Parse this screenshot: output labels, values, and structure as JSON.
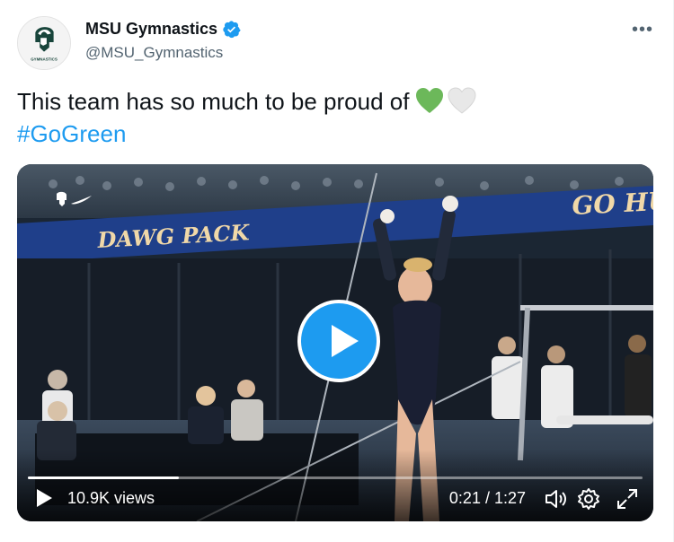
{
  "account": {
    "display_name": "MSU Gymnastics",
    "handle": "@MSU_Gymnastics",
    "avatar_text": "GYMNASTICS"
  },
  "tweet": {
    "text": "This team has so much to be proud of",
    "hashtag": "#GoGreen",
    "emojis": [
      "green-heart",
      "white-heart"
    ]
  },
  "video": {
    "views": "10.9K views",
    "time": "0:21 / 1:27",
    "progress": 0.245,
    "banner_left": "DAWG PACK",
    "banner_right": "GO HU"
  },
  "colors": {
    "accent": "#1d9bf0",
    "text": "#0f1419",
    "secondary": "#536471",
    "green_heart": "#6cb85a"
  },
  "icons": {
    "more": "more-icon",
    "verified": "verified-badge-icon",
    "play": "play-icon",
    "volume": "volume-icon",
    "settings": "gear-icon",
    "fullscreen": "fullscreen-icon"
  }
}
